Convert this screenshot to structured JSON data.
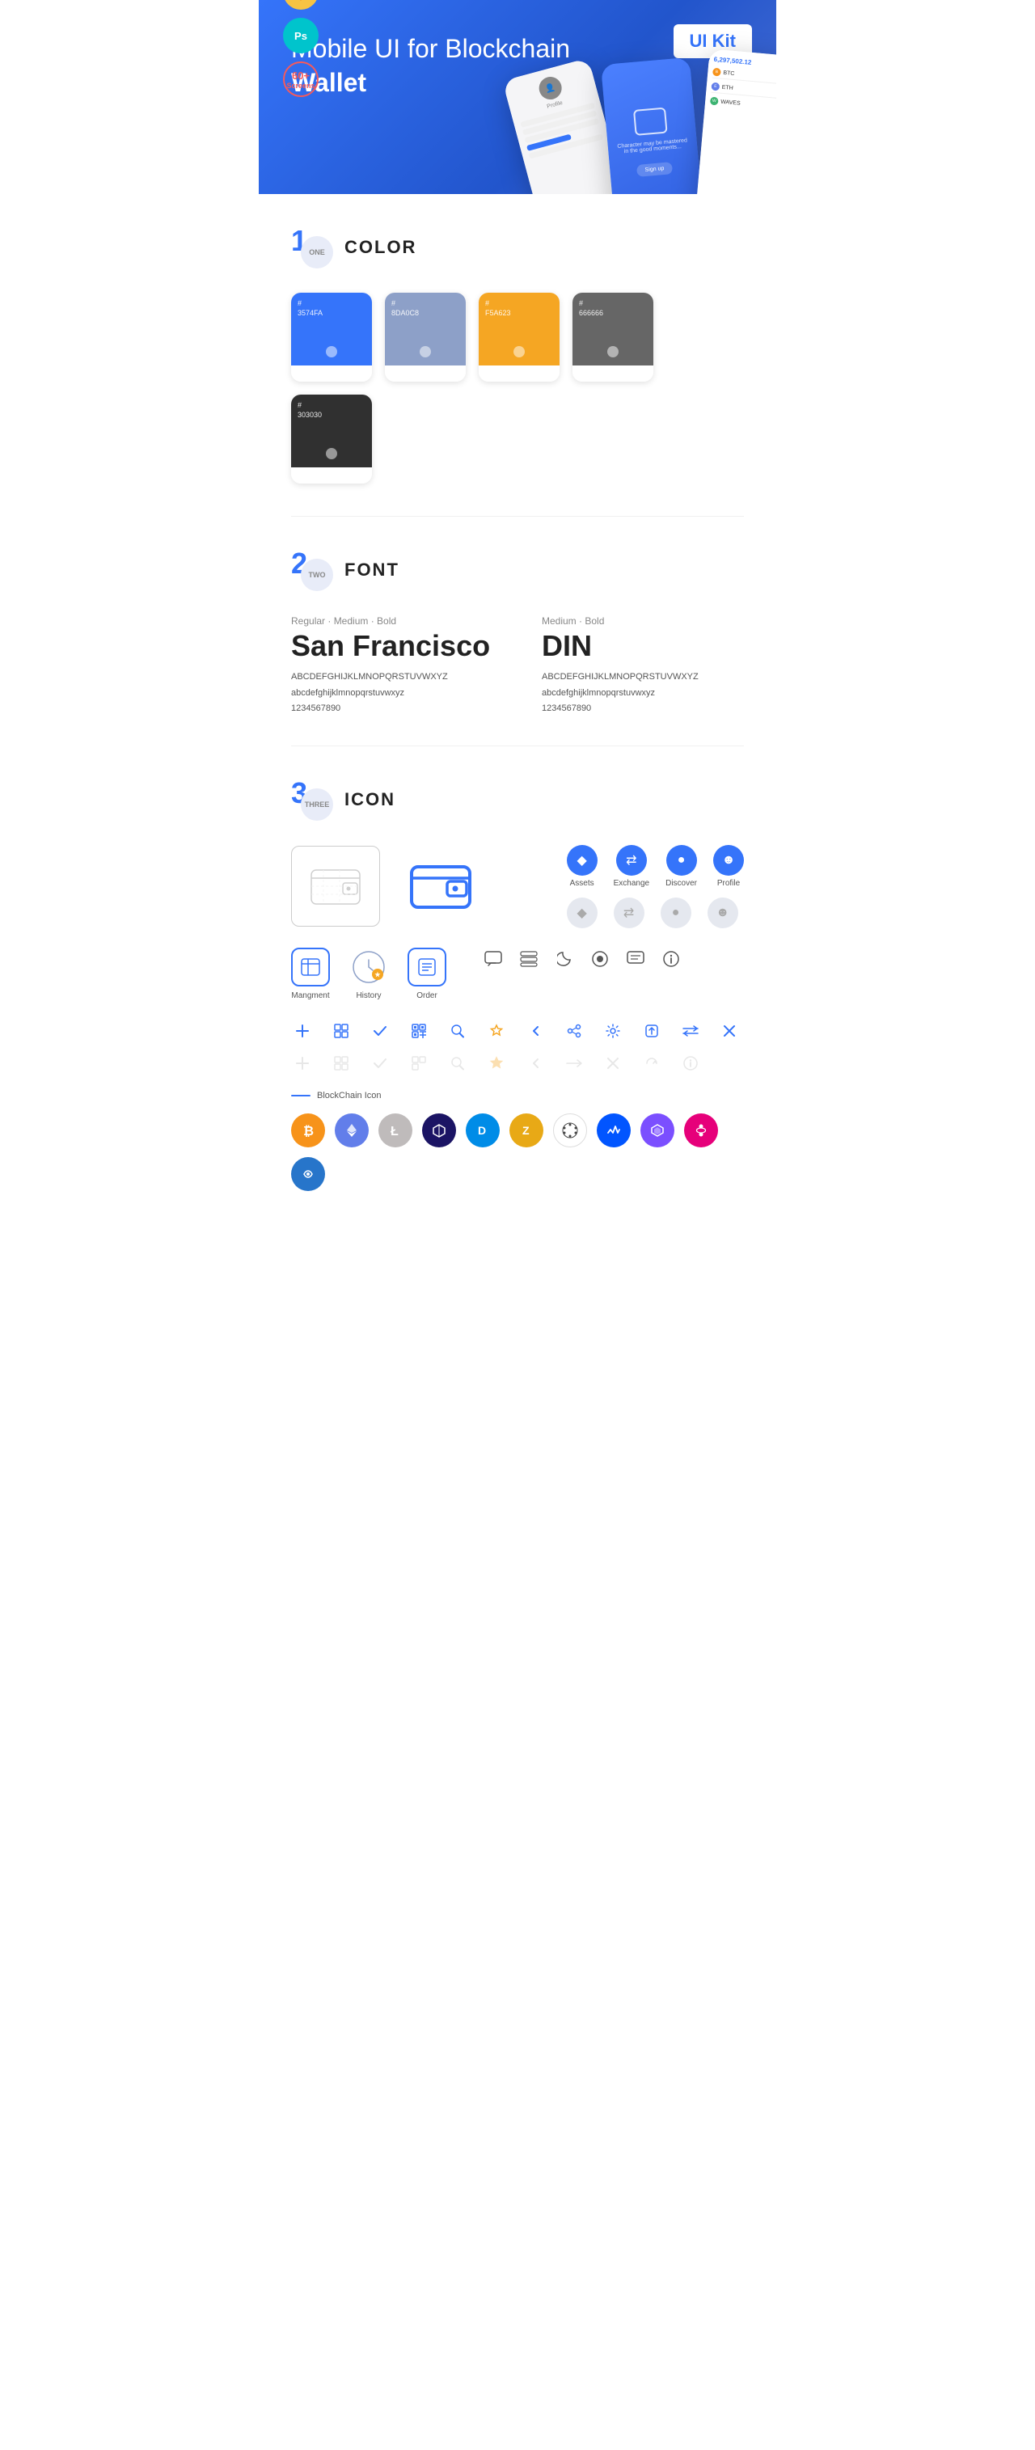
{
  "hero": {
    "title_regular": "Mobile UI for Blockchain ",
    "title_bold": "Wallet",
    "badge": "UI Kit",
    "badges": [
      {
        "type": "sketch",
        "label": "Sketch"
      },
      {
        "type": "ps",
        "label": "Ps"
      },
      {
        "type": "screens",
        "line1": "60+",
        "line2": "Screens"
      }
    ]
  },
  "sections": {
    "color": {
      "number": "1",
      "sublabel": "ONE",
      "title": "COLOR",
      "swatches": [
        {
          "hex": "#3574FA",
          "label": "#\n3574FA"
        },
        {
          "hex": "#8DA0C8",
          "label": "#\n8DA0C8"
        },
        {
          "hex": "#F5A623",
          "label": "#\nF5A623"
        },
        {
          "hex": "#666666",
          "label": "#\n666666"
        },
        {
          "hex": "#303030",
          "label": "#\n303030"
        }
      ]
    },
    "font": {
      "number": "2",
      "sublabel": "TWO",
      "title": "FONT",
      "fonts": [
        {
          "style": "Regular · Medium · Bold",
          "name": "San Francisco",
          "alphabet_upper": "ABCDEFGHIJKLMNOPQRSTUVWXYZ",
          "alphabet_lower": "abcdefghijklmnopqrstuvwxyz",
          "numbers": "1234567890"
        },
        {
          "style": "Medium · Bold",
          "name": "DIN",
          "alphabet_upper": "ABCDEFGHIJKLMNOPQRSTUVWXYZ",
          "alphabet_lower": "abcdefghijklmnopqrstuvwxyz",
          "numbers": "1234567890"
        }
      ]
    },
    "icon": {
      "number": "3",
      "sublabel": "THREE",
      "title": "ICON",
      "labeled_icons": [
        {
          "label": "Assets",
          "symbol": "◆"
        },
        {
          "label": "Exchange",
          "symbol": "↔"
        },
        {
          "label": "Discover",
          "symbol": "●"
        },
        {
          "label": "Profile",
          "symbol": "☻"
        }
      ],
      "app_icons": [
        {
          "label": "Mangment",
          "symbol": "▣"
        },
        {
          "label": "History",
          "symbol": "◷"
        },
        {
          "label": "Order",
          "symbol": "≡"
        }
      ],
      "tool_icons": [
        "+",
        "⊞",
        "✓",
        "⊟",
        "⌕",
        "☆",
        "‹",
        "≪",
        "⚙",
        "⇧",
        "⇔",
        "✕"
      ],
      "blockchain_label": "BlockChain Icon",
      "crypto": [
        {
          "symbol": "₿",
          "color": "#F7931A",
          "name": "Bitcoin"
        },
        {
          "symbol": "⬡",
          "color": "#627EEA",
          "name": "Ethereum"
        },
        {
          "symbol": "Ł",
          "color": "#BFBBBB",
          "name": "Litecoin"
        },
        {
          "symbol": "◈",
          "color": "#1B1464",
          "name": "Byteball"
        },
        {
          "symbol": "D",
          "color": "#008CE7",
          "name": "Dash"
        },
        {
          "symbol": "Z",
          "color": "#B5A642",
          "name": "Zcash"
        },
        {
          "symbol": "◉",
          "color": "#3D3D3D",
          "name": "Unknown"
        },
        {
          "symbol": "⬡",
          "color": "#3CB371",
          "name": "Unknown2"
        },
        {
          "symbol": "△",
          "color": "#7B68EE",
          "name": "Unknown3"
        },
        {
          "symbol": "∞",
          "color": "#4169E1",
          "name": "Polkadot"
        },
        {
          "symbol": "~",
          "color": "#2775CA",
          "name": "Unknown4"
        }
      ]
    }
  }
}
